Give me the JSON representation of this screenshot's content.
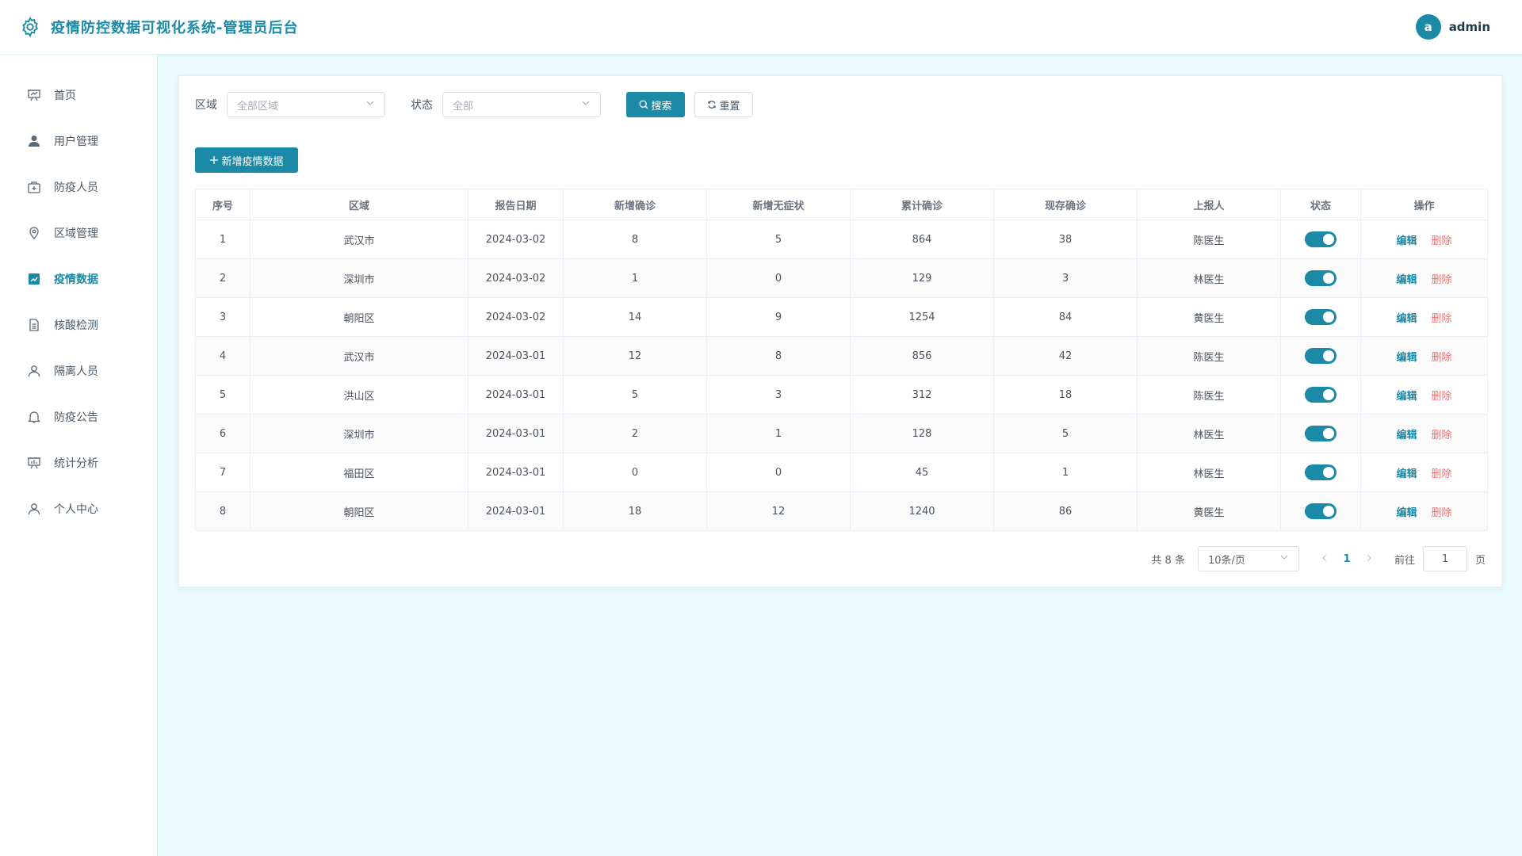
{
  "app": {
    "title": "疫情防控数据可视化系统-管理员后台",
    "accent_color": "#1a8aa6",
    "logo_icon": "gear-icon"
  },
  "user": {
    "avatar_letter": "a",
    "name": "admin"
  },
  "sidebar": {
    "items": [
      {
        "label": "首页",
        "icon": "dashboard-icon",
        "active": false
      },
      {
        "label": "用户管理",
        "icon": "user-icon",
        "active": false
      },
      {
        "label": "防疫人员",
        "icon": "medical-kit-icon",
        "active": false
      },
      {
        "label": "区域管理",
        "icon": "location-icon",
        "active": false
      },
      {
        "label": "疫情数据",
        "icon": "chart-icon",
        "active": true
      },
      {
        "label": "核酸检测",
        "icon": "document-icon",
        "active": false
      },
      {
        "label": "隔离人员",
        "icon": "person-icon",
        "active": false
      },
      {
        "label": "防疫公告",
        "icon": "bell-icon",
        "active": false
      },
      {
        "label": "统计分析",
        "icon": "presentation-icon",
        "active": false
      },
      {
        "label": "个人中心",
        "icon": "person-outline-icon",
        "active": false
      }
    ]
  },
  "filters": {
    "region_label": "区域",
    "region_placeholder": "全部区域",
    "status_label": "状态",
    "status_placeholder": "全部",
    "search_label": "搜索",
    "reset_label": "重置"
  },
  "add_button_label": "新增疫情数据",
  "table": {
    "columns": [
      "序号",
      "区域",
      "报告日期",
      "新增确诊",
      "新增无症状",
      "累计确诊",
      "现存确诊",
      "上报人",
      "状态",
      "操作"
    ],
    "rows": [
      {
        "no": "1",
        "region": "武汉市",
        "date": "2024-03-02",
        "new_confirmed": "8",
        "new_asymptomatic": "5",
        "total_confirmed": "864",
        "current_confirmed": "38",
        "reporter": "陈医生",
        "status_on": true
      },
      {
        "no": "2",
        "region": "深圳市",
        "date": "2024-03-02",
        "new_confirmed": "1",
        "new_asymptomatic": "0",
        "total_confirmed": "129",
        "current_confirmed": "3",
        "reporter": "林医生",
        "status_on": true
      },
      {
        "no": "3",
        "region": "朝阳区",
        "date": "2024-03-02",
        "new_confirmed": "14",
        "new_asymptomatic": "9",
        "total_confirmed": "1254",
        "current_confirmed": "84",
        "reporter": "黄医生",
        "status_on": true
      },
      {
        "no": "4",
        "region": "武汉市",
        "date": "2024-03-01",
        "new_confirmed": "12",
        "new_asymptomatic": "8",
        "total_confirmed": "856",
        "current_confirmed": "42",
        "reporter": "陈医生",
        "status_on": true
      },
      {
        "no": "5",
        "region": "洪山区",
        "date": "2024-03-01",
        "new_confirmed": "5",
        "new_asymptomatic": "3",
        "total_confirmed": "312",
        "current_confirmed": "18",
        "reporter": "陈医生",
        "status_on": true
      },
      {
        "no": "6",
        "region": "深圳市",
        "date": "2024-03-01",
        "new_confirmed": "2",
        "new_asymptomatic": "1",
        "total_confirmed": "128",
        "current_confirmed": "5",
        "reporter": "林医生",
        "status_on": true
      },
      {
        "no": "7",
        "region": "福田区",
        "date": "2024-03-01",
        "new_confirmed": "0",
        "new_asymptomatic": "0",
        "total_confirmed": "45",
        "current_confirmed": "1",
        "reporter": "林医生",
        "status_on": true
      },
      {
        "no": "8",
        "region": "朝阳区",
        "date": "2024-03-01",
        "new_confirmed": "18",
        "new_asymptomatic": "12",
        "total_confirmed": "1240",
        "current_confirmed": "86",
        "reporter": "黄医生",
        "status_on": true
      }
    ],
    "edit_label": "编辑",
    "delete_label": "删除",
    "delete_color": "#f56c6c"
  },
  "pagination": {
    "total_text": "共 8 条",
    "page_size": "10条/页",
    "current_page": "1",
    "goto_label": "前往",
    "goto_value": "1",
    "page_suffix": "页"
  }
}
